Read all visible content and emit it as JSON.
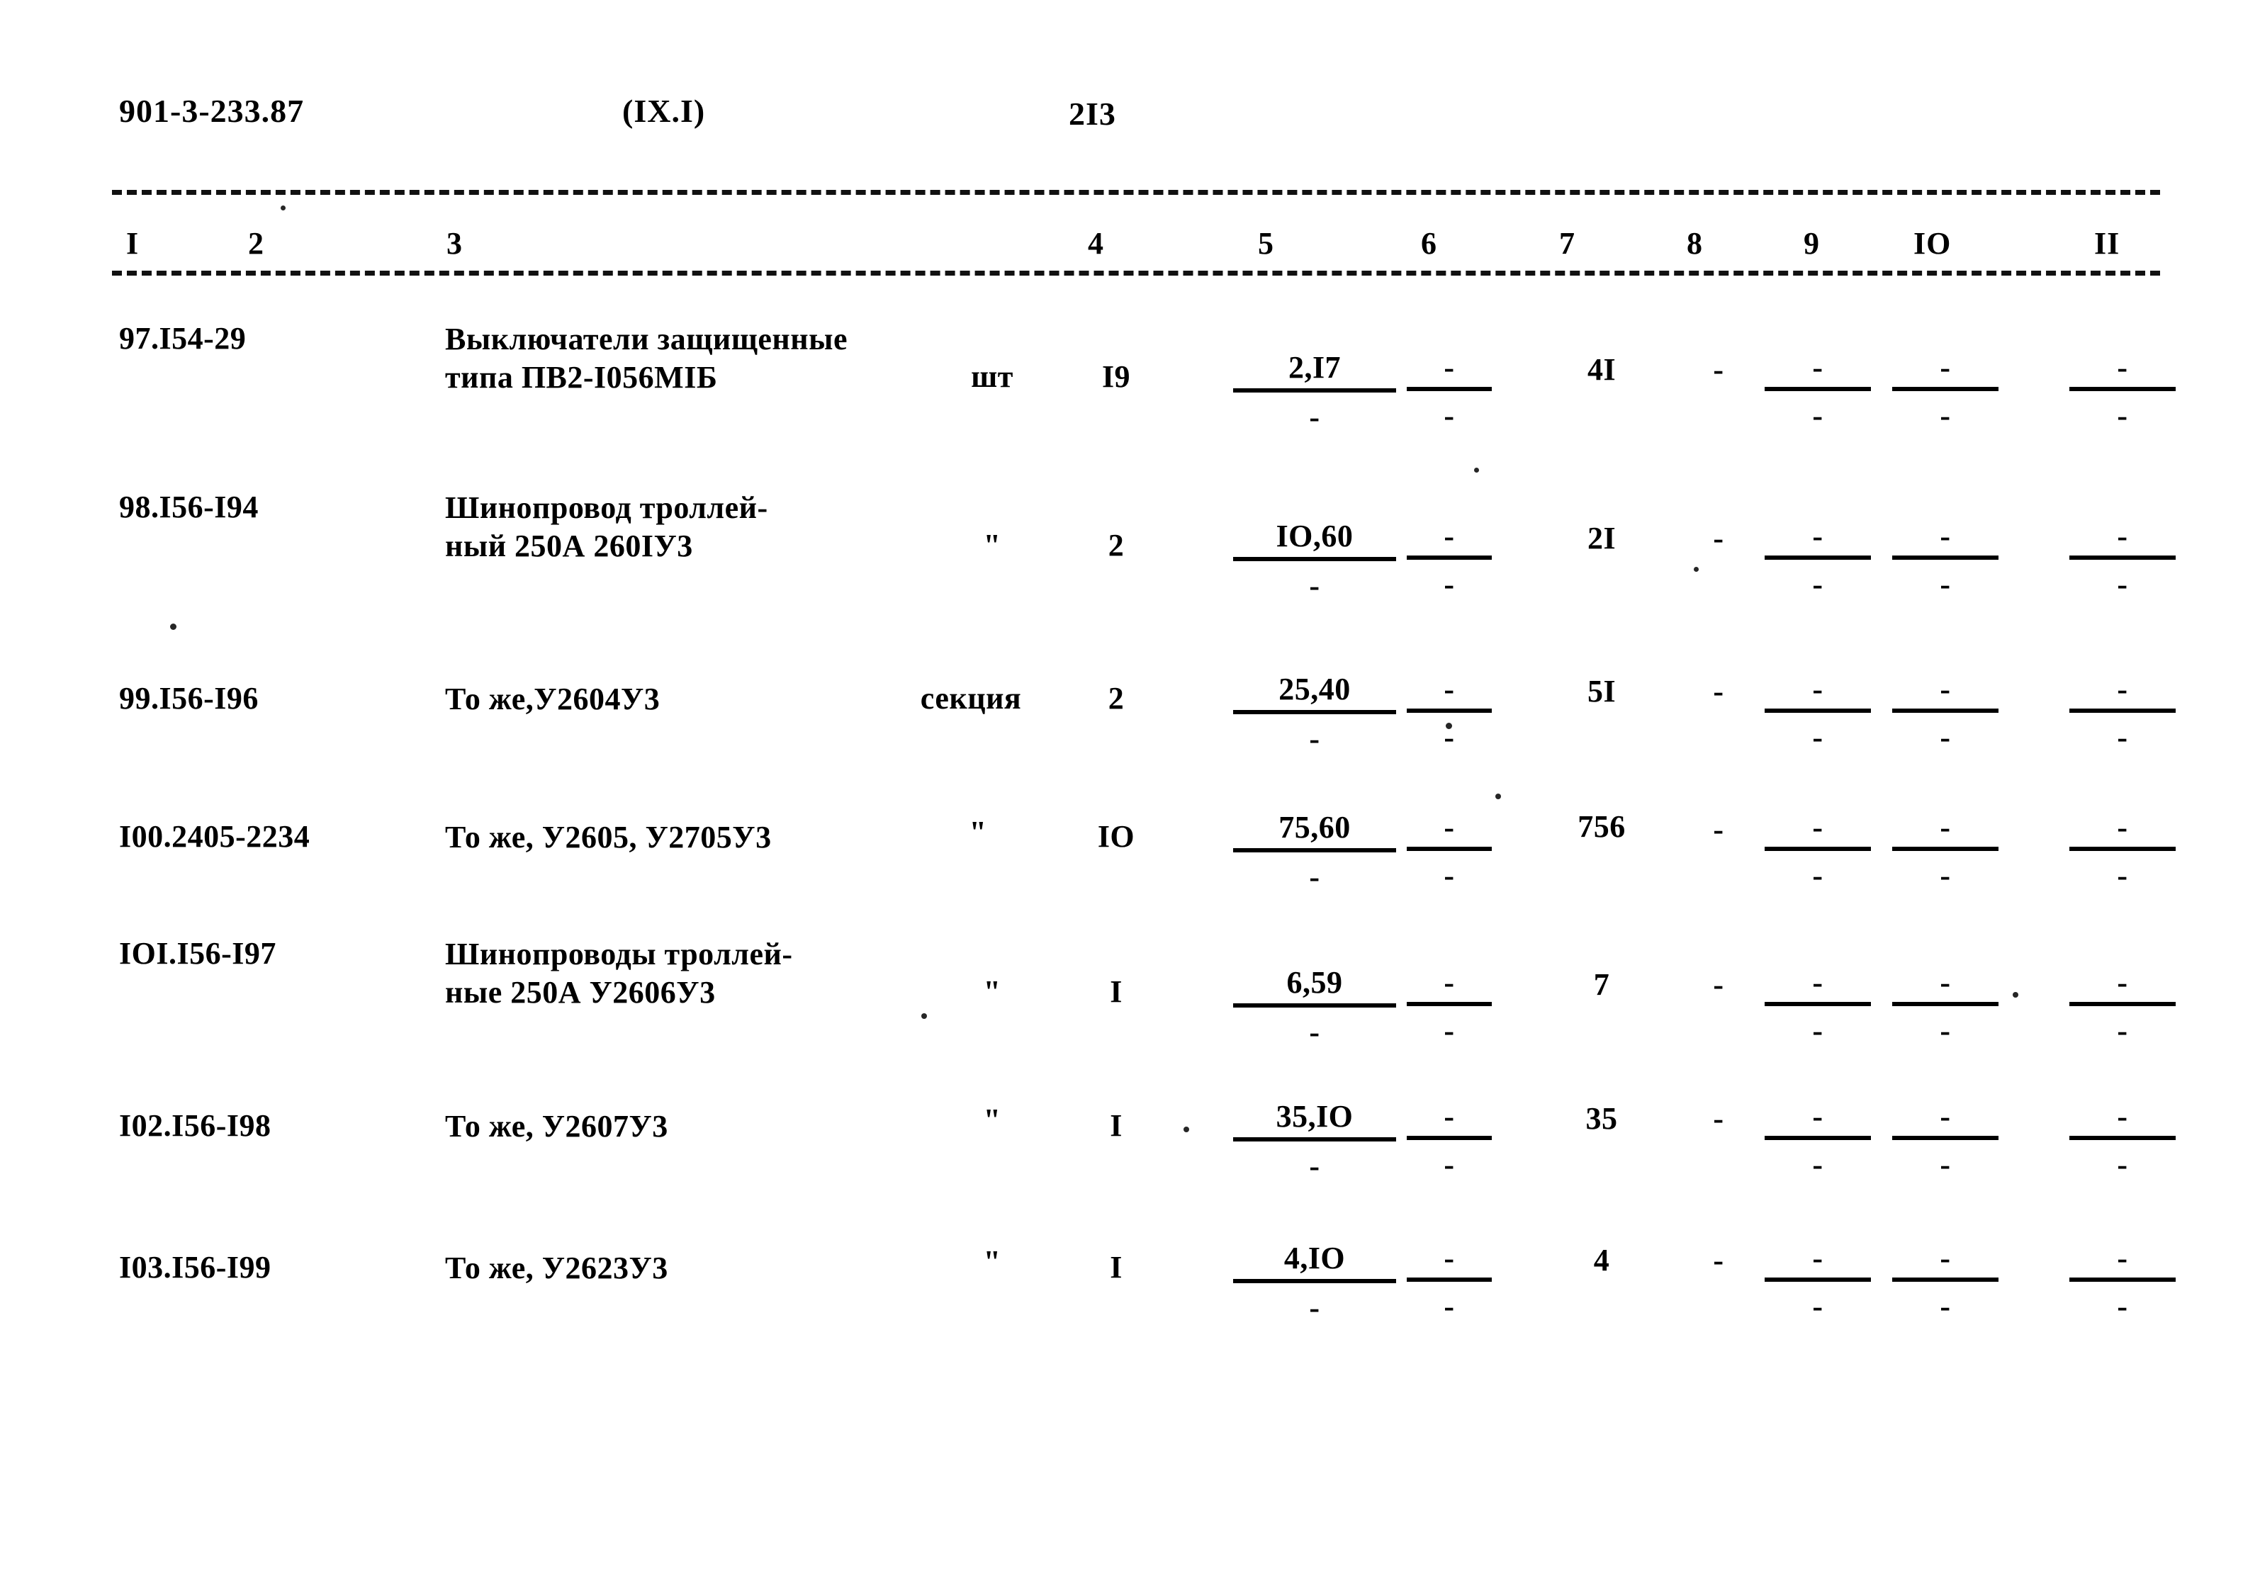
{
  "header": {
    "doc_code": "901-3-233.87",
    "section": "(IX.I)",
    "page_number": "2I3"
  },
  "table": {
    "column_numbers": [
      "I",
      "2",
      "3",
      "4",
      "5",
      "6",
      "7",
      "8",
      "9",
      "IO",
      "II"
    ],
    "rows": [
      {
        "code": "97.I54-29",
        "description": "Выключатели защищенные\nтипа ПВ2-I056МIБ",
        "unit": "шт",
        "qty": "I9",
        "col5_num": "2,I7",
        "col5_den": "-",
        "col6_num": "-",
        "col6_den": "-",
        "col7": "4I",
        "col8": "-",
        "col9_num": "-",
        "col9_den": "-",
        "col10_num": "-",
        "col10_den": "-",
        "col11_num": "-",
        "col11_den": "-"
      },
      {
        "code": "98.I56-I94",
        "description": "Шинопровод троллей-\nный 250А 260IУ3",
        "unit": "\"",
        "qty": "2",
        "col5_num": "IO,60",
        "col5_den": "-",
        "col6_num": "-",
        "col6_den": "-",
        "col7": "2I",
        "col8": "-",
        "col9_num": "-",
        "col9_den": "-",
        "col10_num": "-",
        "col10_den": "-",
        "col11_num": "-",
        "col11_den": "-"
      },
      {
        "code": "99.I56-I96",
        "description": "То же,У2604У3",
        "unit": "секция",
        "qty": "2",
        "col5_num": "25,40",
        "col5_den": "-",
        "col6_num": "-",
        "col6_den": "-",
        "col7": "5I",
        "col8": "-",
        "col9_num": "-",
        "col9_den": "-",
        "col10_num": "-",
        "col10_den": "-",
        "col11_num": "-",
        "col11_den": "-"
      },
      {
        "code": "I00.2405-2234",
        "description": "То же, У2605, У2705У3",
        "unit": "\"",
        "qty": "IO",
        "col5_num": "75,60",
        "col5_den": "-",
        "col6_num": "-",
        "col6_den": "-",
        "col7": "756",
        "col8": "-",
        "col9_num": "-",
        "col9_den": "-",
        "col10_num": "-",
        "col10_den": "-",
        "col11_num": "-",
        "col11_den": "-"
      },
      {
        "code": "IOI.I56-I97",
        "description": "Шинопроводы троллей-\nные 250А У2606У3",
        "unit": "\"",
        "qty": "I",
        "col5_num": "6,59",
        "col5_den": "-",
        "col6_num": "-",
        "col6_den": "-",
        "col7": "7",
        "col8": "-",
        "col9_num": "-",
        "col9_den": "-",
        "col10_num": "-",
        "col10_den": "-",
        "col11_num": "-",
        "col11_den": "-"
      },
      {
        "code": "I02.I56-I98",
        "description": "То же, У2607У3",
        "unit": "\"",
        "qty": "I",
        "col5_num": "35,IO",
        "col5_den": "-",
        "col6_num": "-",
        "col6_den": "-",
        "col7": "35",
        "col8": "-",
        "col9_num": "-",
        "col9_den": "-",
        "col10_num": "-",
        "col10_den": "-",
        "col11_num": "-",
        "col11_den": "-"
      },
      {
        "code": "I03.I56-I99",
        "description": "То же, У2623У3",
        "unit": "\"",
        "qty": "I",
        "col5_num": "4,IO",
        "col5_den": "-",
        "col6_num": "-",
        "col6_den": "-",
        "col7": "4",
        "col8": "-",
        "col9_num": "-",
        "col9_den": "-",
        "col10_num": "-",
        "col10_den": "-",
        "col11_num": "-",
        "col11_den": "-"
      }
    ]
  }
}
